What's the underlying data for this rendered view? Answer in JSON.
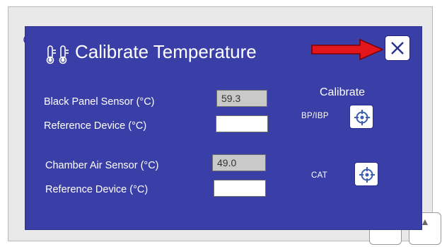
{
  "dialog": {
    "title": "Calibrate Temperature",
    "icons": {
      "title": "thermometer-icon",
      "close": "close-icon",
      "pointer": "red-arrow"
    },
    "colors": {
      "dialog_bg": "#3a3fa8",
      "arrow": "#e3161b",
      "calibrate_icon": "#3a5fae"
    }
  },
  "sensors": [
    {
      "label": "Black Panel Sensor (°C)",
      "value": "59.3",
      "reference_label": "Reference Device (°C)",
      "reference_value": ""
    },
    {
      "label": "Chamber Air Sensor (°C)",
      "value": "49.0",
      "reference_label": "Reference Device (°C)",
      "reference_value": ""
    }
  ],
  "calibrate": {
    "heading": "Calibrate",
    "buttons": [
      {
        "label": "BP/IBP",
        "icon": "target-icon"
      },
      {
        "label": "CAT",
        "icon": "target-icon"
      }
    ]
  }
}
